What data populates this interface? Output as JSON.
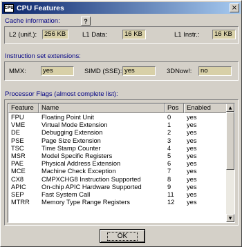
{
  "window": {
    "title": "CPU Features",
    "icon": "cpu-chip-icon",
    "close": "×"
  },
  "cache": {
    "label": "Cache information:",
    "help": "?",
    "l2_label": "L2 (unif.):",
    "l2_value": "256 KB",
    "l1d_label": "L1 Data:",
    "l1d_value": "16 KB",
    "l1i_label": "L1 Instr.:",
    "l1i_value": "16 KB"
  },
  "isa": {
    "label": "Instruction set extensions:",
    "mmx_label": "MMX:",
    "mmx_value": "yes",
    "simd_label": "SIMD (SSE):",
    "simd_value": "yes",
    "now_label": "3DNow!:",
    "now_value": "no"
  },
  "flags": {
    "label": "Processor Flags (almost complete list):",
    "columns": [
      "Feature",
      "Name",
      "Pos",
      "Enabled"
    ],
    "rows": [
      {
        "feature": "FPU",
        "name": "Floating Point Unit",
        "pos": "0",
        "enabled": "yes"
      },
      {
        "feature": "VME",
        "name": "Virtual Mode Extension",
        "pos": "1",
        "enabled": "yes"
      },
      {
        "feature": "DE",
        "name": "Debugging Extension",
        "pos": "2",
        "enabled": "yes"
      },
      {
        "feature": "PSE",
        "name": "Page Size Extension",
        "pos": "3",
        "enabled": "yes"
      },
      {
        "feature": "TSC",
        "name": "Time Stamp Counter",
        "pos": "4",
        "enabled": "yes"
      },
      {
        "feature": "MSR",
        "name": "Model Specific Registers",
        "pos": "5",
        "enabled": "yes"
      },
      {
        "feature": "PAE",
        "name": "Physical Address Extension",
        "pos": "6",
        "enabled": "yes"
      },
      {
        "feature": "MCE",
        "name": "Machine Check Exception",
        "pos": "7",
        "enabled": "yes"
      },
      {
        "feature": "CX8",
        "name": "CMPXCHG8 Instruction Supported",
        "pos": "8",
        "enabled": "yes"
      },
      {
        "feature": "APIC",
        "name": "On-chip APIC Hardware Supported",
        "pos": "9",
        "enabled": "yes"
      },
      {
        "feature": "SEP",
        "name": "Fast System Call",
        "pos": "11",
        "enabled": "yes"
      },
      {
        "feature": "MTRR",
        "name": "Memory Type Range Registers",
        "pos": "12",
        "enabled": "yes"
      }
    ]
  },
  "ok_label": "OK",
  "colors": {
    "title_start": "#0a246a",
    "title_end": "#a6caf0",
    "section_label": "#000084",
    "field_bg": "#d8d0a8"
  }
}
